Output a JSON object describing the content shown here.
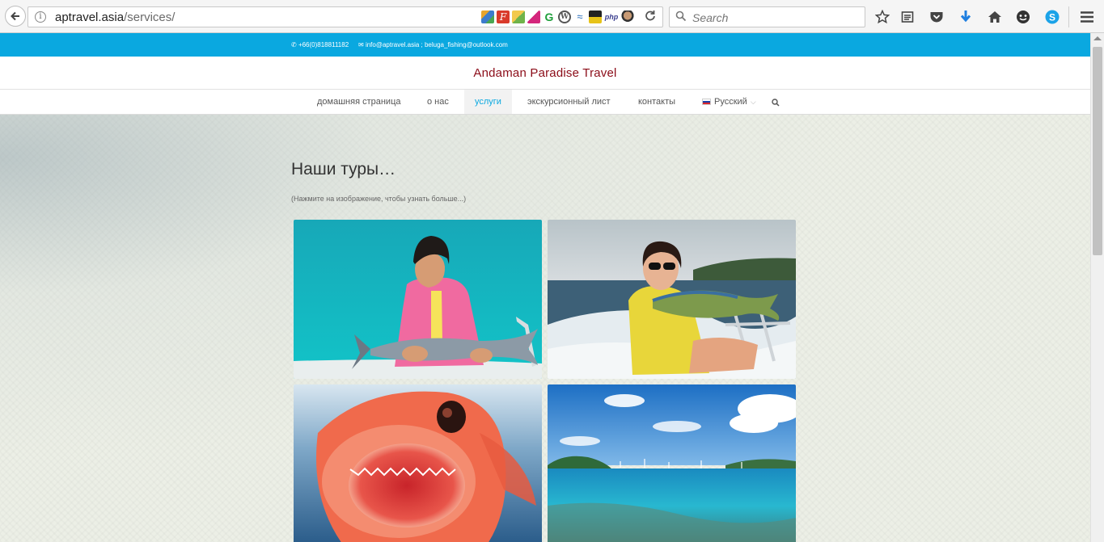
{
  "browser": {
    "url_host": "aptravel.asia",
    "url_path": "/services/",
    "search_placeholder": "Search"
  },
  "topbar": {
    "phone": "+66(0)818811182",
    "email": "info@aptravel.asia ; beluga_fishing@outlook.com"
  },
  "site_title": "Andaman Paradise Travel",
  "nav": {
    "items": [
      "домашняя страница",
      "о нас",
      "услуги",
      "экскурсионный лист",
      "контакты"
    ],
    "active": "услуги",
    "language": "Русский"
  },
  "main": {
    "heading": "Наши туры…",
    "subtext": "(Нажмите на изображение, чтобы узнать больше...)"
  },
  "tiles": [
    {
      "subject": "girl-with-tuna-photo"
    },
    {
      "subject": "woman-with-mahi-mahi-photo"
    },
    {
      "subject": "red-grouper-closeup-photo"
    },
    {
      "subject": "island-bay-photo"
    }
  ]
}
